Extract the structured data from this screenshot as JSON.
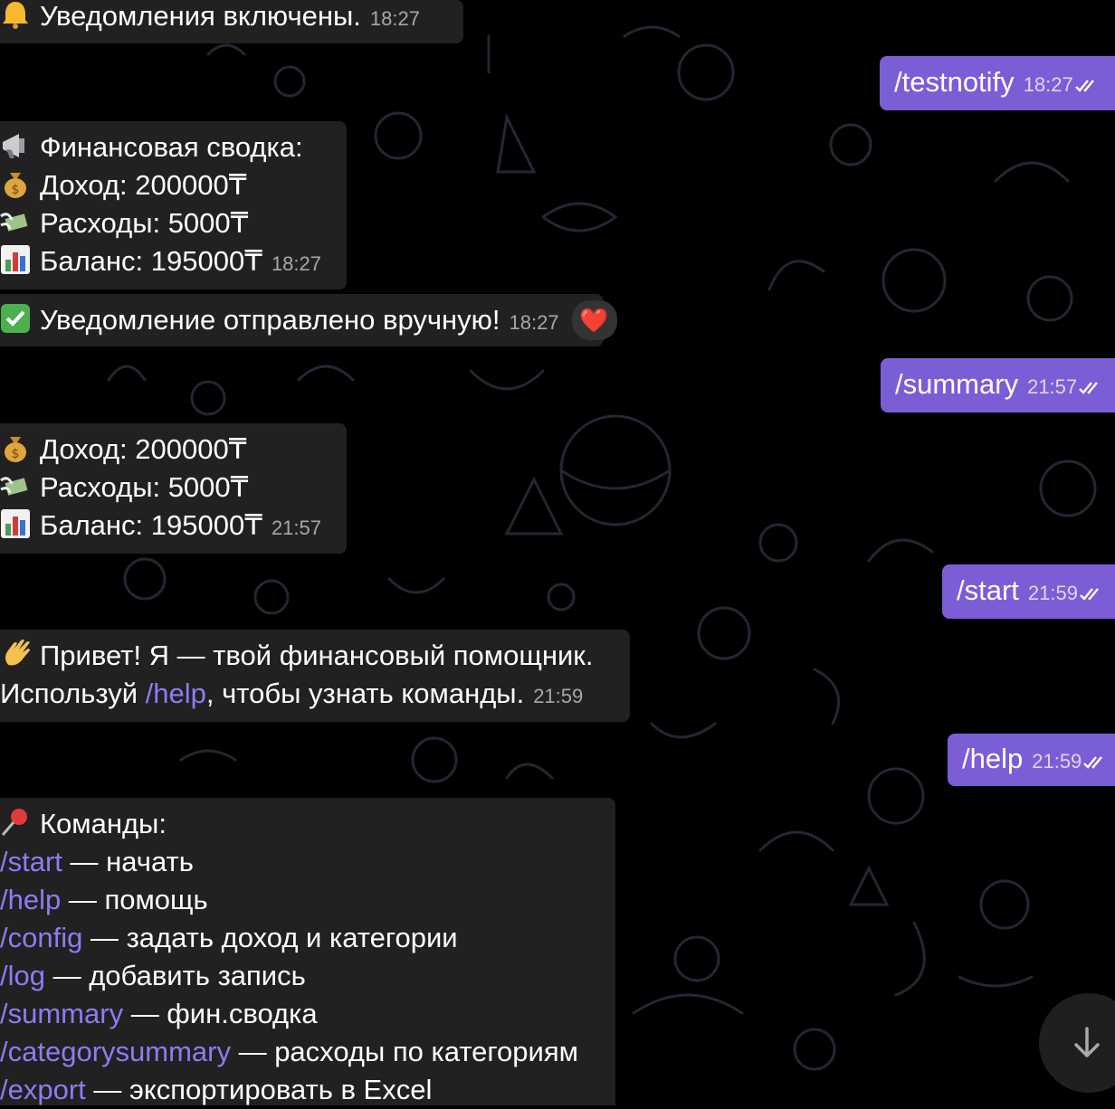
{
  "messages": {
    "notifications_on": {
      "text": "Уведомления включены.",
      "time": "18:27"
    },
    "testnotify": {
      "text": "/testnotify",
      "time": "18:27"
    },
    "fin_summary": {
      "title": "Финансовая сводка:",
      "income": "Доход: 200000₸",
      "expenses": "Расходы: 5000₸",
      "balance": "Баланс: 195000₸",
      "time": "18:27"
    },
    "manual_sent": {
      "text": "Уведомление отправлено вручную!",
      "time": "18:27",
      "reaction": "❤️"
    },
    "summary_cmd": {
      "text": "/summary",
      "time": "21:57"
    },
    "summary_reply": {
      "income": "Доход: 200000₸",
      "expenses": "Расходы: 5000₸",
      "balance": "Баланс: 195000₸",
      "time": "21:57"
    },
    "start_cmd": {
      "text": "/start",
      "time": "21:59"
    },
    "greeting": {
      "line1": "Привет! Я — твой финансовый помощник.",
      "line2_prefix": "Используй ",
      "line2_link": "/help",
      "line2_suffix": ", чтобы узнать команды.",
      "time": "21:59"
    },
    "help_cmd": {
      "text": "/help",
      "time": "21:59"
    },
    "commands": {
      "title": "Команды:",
      "items": [
        {
          "cmd": "/start",
          "desc": " — начать"
        },
        {
          "cmd": "/help",
          "desc": " — помощь"
        },
        {
          "cmd": "/config",
          "desc": " — задать доход и категории"
        },
        {
          "cmd": "/log",
          "desc": " — добавить запись"
        },
        {
          "cmd": "/summary",
          "desc": " — фин.сводка"
        },
        {
          "cmd": "/categorysummary",
          "desc": " — расходы по категориям"
        },
        {
          "cmd": "/export",
          "desc": " — экспортировать в Excel"
        }
      ]
    }
  },
  "icons": {
    "bell": "bell-icon",
    "megaphone": "megaphone-icon",
    "money_bag": "money-bag-icon",
    "money_wings": "money-with-wings-icon",
    "chart": "bar-chart-icon",
    "check": "check-mark-icon",
    "wave": "waving-hand-icon",
    "pin": "pushpin-icon",
    "read": "double-check-icon",
    "scroll": "arrow-down-icon"
  },
  "colors": {
    "background": "#000000",
    "incoming": "#212121",
    "outgoing": "#7b5ed6",
    "link": "#8e7cf2"
  }
}
